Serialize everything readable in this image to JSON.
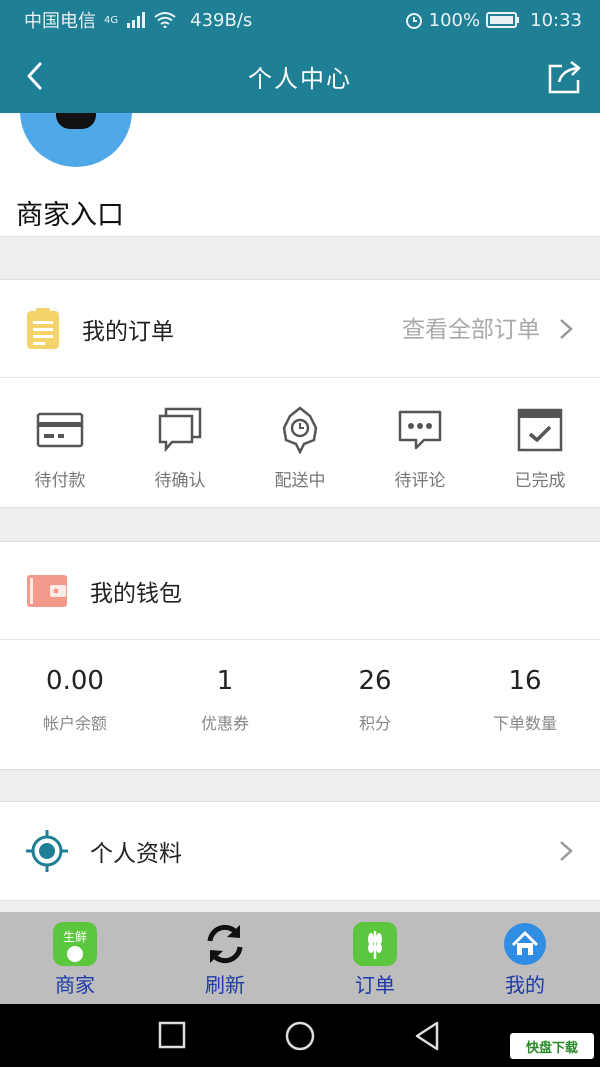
{
  "status_bar": {
    "carrier": "中国电信",
    "network": "4G",
    "speed": "439B/s",
    "battery": "100%",
    "time": "10:33"
  },
  "nav": {
    "title": "个人中心"
  },
  "profile": {
    "merchant_entry": "商家入口"
  },
  "orders": {
    "title": "我的订单",
    "view_all": "查看全部订单",
    "items": [
      {
        "label": "待付款",
        "icon": "card-icon"
      },
      {
        "label": "待确认",
        "icon": "chat-boxes-icon"
      },
      {
        "label": "配送中",
        "icon": "delivery-icon"
      },
      {
        "label": "待评论",
        "icon": "comment-icon"
      },
      {
        "label": "已完成",
        "icon": "calendar-check-icon"
      }
    ]
  },
  "wallet": {
    "title": "我的钱包",
    "stats": [
      {
        "value": "0.00",
        "label": "帐户余额"
      },
      {
        "value": "1",
        "label": "优惠券"
      },
      {
        "value": "26",
        "label": "积分"
      },
      {
        "value": "16",
        "label": "下单数量"
      }
    ]
  },
  "profile_info": {
    "title": "个人资料"
  },
  "tabbar": {
    "items": [
      {
        "label": "商家",
        "icon_text": "生鲜"
      },
      {
        "label": "刷新"
      },
      {
        "label": "订单"
      },
      {
        "label": "我的"
      }
    ]
  },
  "watermark": "快盘下载",
  "colors": {
    "primary": "#1f7f95",
    "tab_label": "#1d3aa8",
    "order_icon": "#f5d36b",
    "wallet_icon": "#f39a8a",
    "profile_icon": "#1f7f95"
  }
}
